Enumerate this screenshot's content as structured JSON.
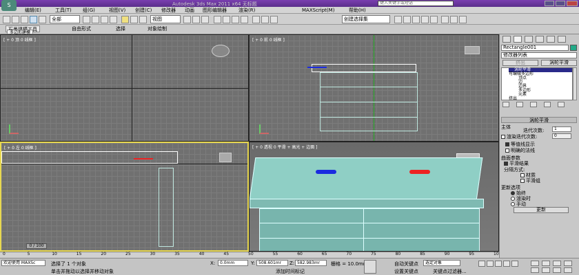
{
  "title_bar": {
    "title": "Autodesk 3ds Max 2011 x64    无标题",
    "search_placeholder": "键入关键字或短语"
  },
  "menu": [
    "编辑(E)",
    "工具(T)",
    "组(G)",
    "视图(V)",
    "创建(C)",
    "修改器",
    "动画",
    "图形编辑器",
    "渲染(R)",
    "MAXScript(M)",
    "帮助(H)"
  ],
  "toolbar": {
    "selection_filter": "全部",
    "coord_system": "视图",
    "named_selection": "创建选择集"
  },
  "ribbon": {
    "tabs": [
      "石墨建模工具",
      "自由形式",
      "选择",
      "对象绘制"
    ],
    "subtab": "多边形建模"
  },
  "viewports": {
    "top": {
      "label": "[ + 0 顶 0 线框 ]"
    },
    "front": {
      "label": "[ + 0 前 0 线框 ]"
    },
    "left": {
      "label": "[ + 0 左 0 线框 ]"
    },
    "persp": {
      "label": "[ + 0 透视 0 平滑 + 高光 + 边面 ]"
    }
  },
  "command_panel": {
    "object_name": "Rectangle001",
    "modifier_list": "修改器列表",
    "buttons": [
      "挤出",
      "涡轮平滑"
    ],
    "stack": [
      "涡轮平滑",
      "可编辑多边形",
      "顶点",
      "边",
      "边界",
      "多边形",
      "元素",
      "挤出"
    ],
    "rollout_title": "涡轮平滑",
    "main_label": "主体",
    "iterations_label": "迭代次数:",
    "iterations_value": "1",
    "render_iters_label": "渲染迭代次数:",
    "render_iters_value": "0",
    "isoline_label": "等值线显示",
    "explicit_normals_label": "明确的法线",
    "surface_params_label": "曲面参数",
    "smooth_result_label": "平滑结果",
    "separate_by_label": "分隔方式:",
    "materials_label": "材质",
    "smoothing_groups_label": "平滑组",
    "update_options_label": "更新选项",
    "always_label": "始终",
    "when_render_label": "渲染时",
    "manual_label": "手动",
    "update_button": "更新"
  },
  "timeline": {
    "frame": "0 / 100",
    "ticks": [
      "0",
      "5",
      "10",
      "15",
      "20",
      "25",
      "30",
      "35",
      "40",
      "45",
      "50",
      "55",
      "60",
      "65",
      "70",
      "75",
      "80",
      "85",
      "90",
      "95",
      "100"
    ]
  },
  "status": {
    "welcome": "欢迎使用 MAXSc",
    "selected": "选择了 1 个对象",
    "hint": "单击并拖动以选择并移动对象",
    "x_label": "X:",
    "x_value": "0.0mm",
    "y_label": "Y:",
    "y_value": "508.601mr",
    "z_label": "Z:",
    "z_value": "582.983mr",
    "grid_label": "栅格 = 10.0mm",
    "autokey": "自动关键点",
    "selected_obj": "选定对象",
    "setkey": "设置关键点",
    "keyfilter": "关键点过滤器...",
    "add_time_tag": "添加时间标记"
  },
  "colors": {
    "accent": "#5a2d8a",
    "selection_yellow": "#e8d850",
    "model_cyan": "#bfe8e0"
  }
}
